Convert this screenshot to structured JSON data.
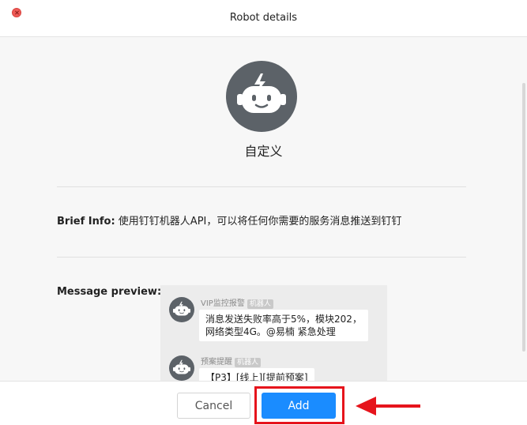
{
  "window": {
    "title": "Robot details",
    "close_icon": "close-icon"
  },
  "robot": {
    "name": "自定义",
    "avatar_icon": "robot-icon"
  },
  "brief": {
    "label": "Brief Info:",
    "text": "使用钉钉机器人API，可以将任何你需要的服务消息推送到钉钉"
  },
  "preview": {
    "label": "Message preview:",
    "messages": [
      {
        "sender": "VIP监控报警",
        "tag": "机器人",
        "lines": [
          "消息发送失败率高于5%，模块202，",
          "网络类型4G。@易楠 紧急处理"
        ]
      },
      {
        "sender": "预案提醒",
        "tag": "机器人",
        "lines": [
          "【P3】[线上][提前预案]"
        ]
      }
    ]
  },
  "footer": {
    "cancel_label": "Cancel",
    "add_label": "Add"
  },
  "colors": {
    "primary": "#1a8cff",
    "highlight": "#e6141c",
    "avatar": "#5c6268"
  }
}
